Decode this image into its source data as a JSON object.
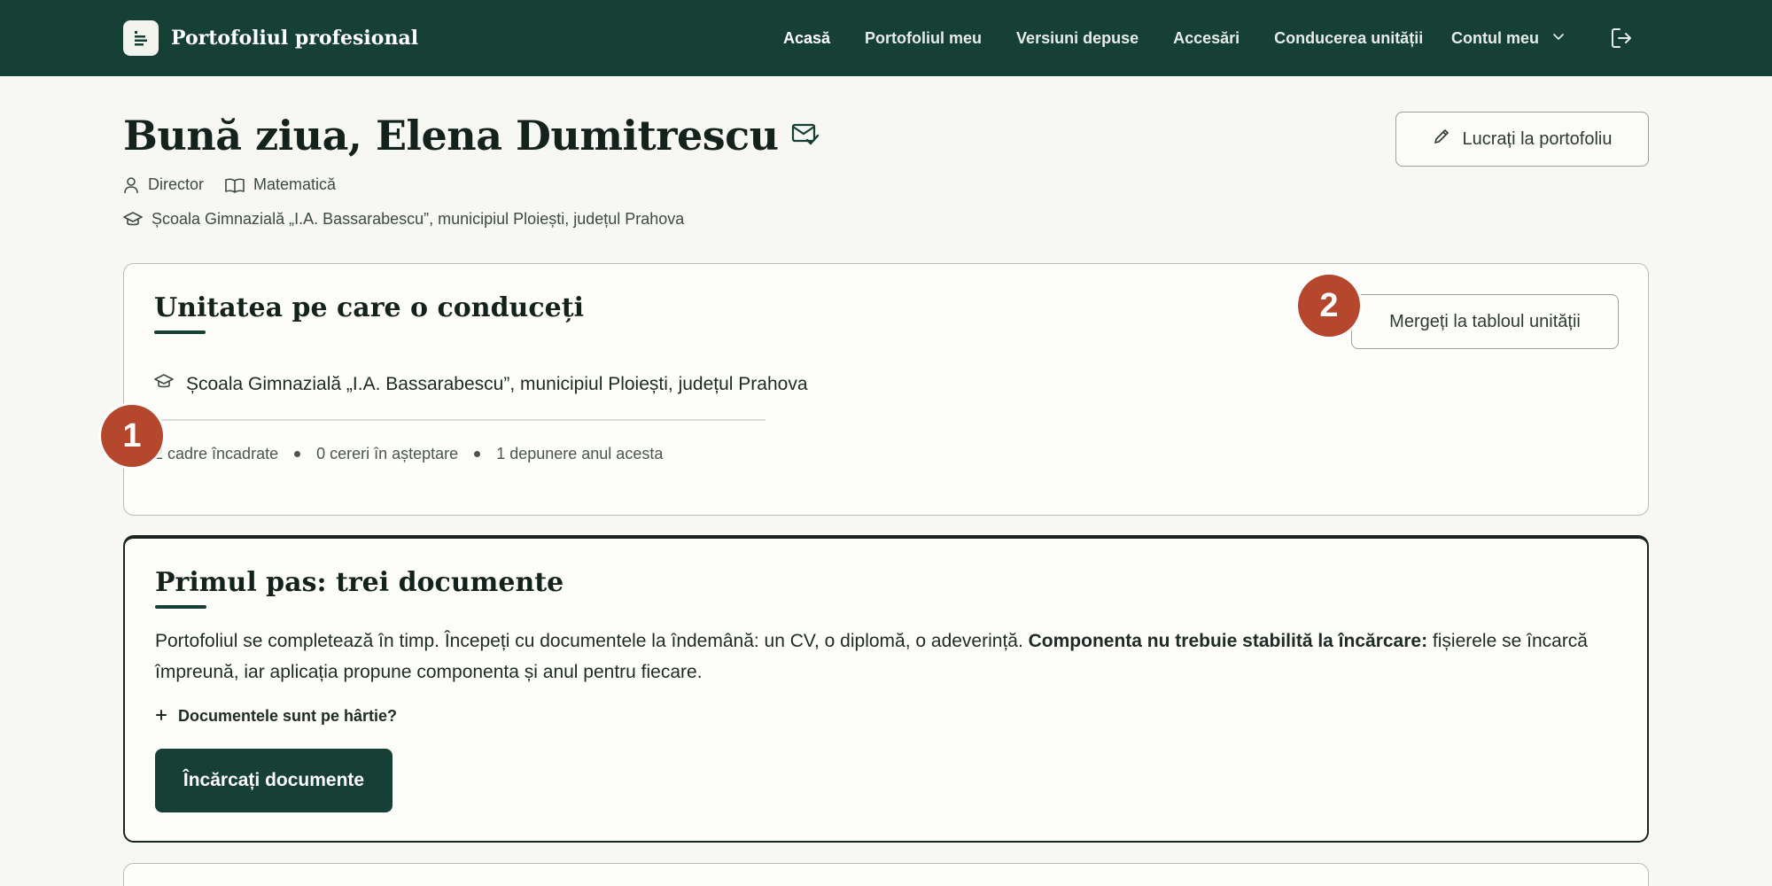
{
  "nav": {
    "brand": "Portofoliul profesional",
    "links": [
      {
        "label": "Acasă",
        "active": true
      },
      {
        "label": "Portofoliul meu"
      },
      {
        "label": "Versiuni depuse"
      },
      {
        "label": "Accesări"
      },
      {
        "label": "Conducerea unității"
      }
    ],
    "account_label": "Contul meu",
    "account_icon": "chevron-down-icon",
    "logout_icon": "logout-icon"
  },
  "header": {
    "greeting": "Bună ziua, Elena Dumitrescu",
    "verified_icon": "mail-check-icon",
    "role": "Director",
    "subject": "Matematică",
    "school": "Școala Gimnazială „I.A. Bassarabescu”, municipiul Ploiești, județul Prahova",
    "work_button": "Lucrați la portofoliu"
  },
  "unit_card": {
    "title": "Unitatea pe care o conduceți",
    "school": "Școala Gimnazială „I.A. Bassarabescu”, municipiul Ploiești, județul Prahova",
    "stats": [
      "2 cadre încadrate",
      "0 cereri în așteptare",
      "1 depunere anul acesta"
    ],
    "dashboard_button": "Mergeți la tabloul unității",
    "markers": [
      "1",
      "2"
    ]
  },
  "first_step": {
    "title": "Primul pas: trei documente",
    "text_plain": "Portofoliul se completează în timp. Începeți cu documentele la îndemână: un CV, o diplomă, o adeverință. ",
    "text_bold": "Componenta nu trebuie stabilită la încărcare:",
    "text_rest": " fișierele se încarcă împreună, iar aplicația propune componenta și anul pentru fiecare.",
    "expand_label": "Documentele sunt pe hârtie?",
    "upload_button": "Încărcați documente"
  },
  "colors": {
    "brand_green": "#163f35",
    "marker": "#b4472c",
    "background": "#f7f7f3"
  }
}
